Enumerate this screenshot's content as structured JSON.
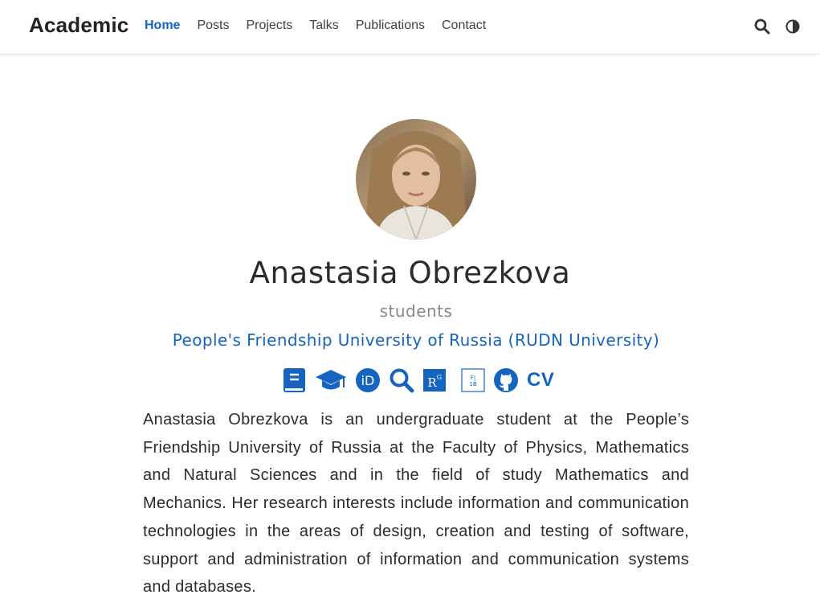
{
  "brand": "Academic",
  "nav": {
    "items": [
      {
        "label": "Home",
        "active": true
      },
      {
        "label": "Posts",
        "active": false
      },
      {
        "label": "Projects",
        "active": false
      },
      {
        "label": "Talks",
        "active": false
      },
      {
        "label": "Publications",
        "active": false
      },
      {
        "label": "Contact",
        "active": false
      }
    ],
    "tools": [
      "search-icon",
      "dark-mode-toggle-icon"
    ]
  },
  "profile": {
    "name": "Anastasia Obrezkova",
    "role": "students",
    "organization": "People's Friendship University of Russia (RUDN University)",
    "social": [
      {
        "icon": "book-icon"
      },
      {
        "icon": "graduation-cap-icon"
      },
      {
        "icon": "orcid-icon"
      },
      {
        "icon": "search-icon"
      },
      {
        "icon": "researchgate-icon"
      },
      {
        "icon": "istina-icon"
      },
      {
        "icon": "github-icon"
      },
      {
        "icon": "cv-link",
        "label": "CV"
      }
    ],
    "bio": "Anastasia Obrezkova is an undergraduate student at the People’s Friendship University of Russia at the Faculty of Physics, Mathematics and Natural Sciences and in the field of study Mathematics and Mechanics. Her research interests include information and communication technologies in the areas of design, creation and testing of software, support and administration of information and communication systems and databases."
  },
  "colors": {
    "accent": "#1565c0",
    "text": "#2b2b2b",
    "muted": "#888888"
  }
}
